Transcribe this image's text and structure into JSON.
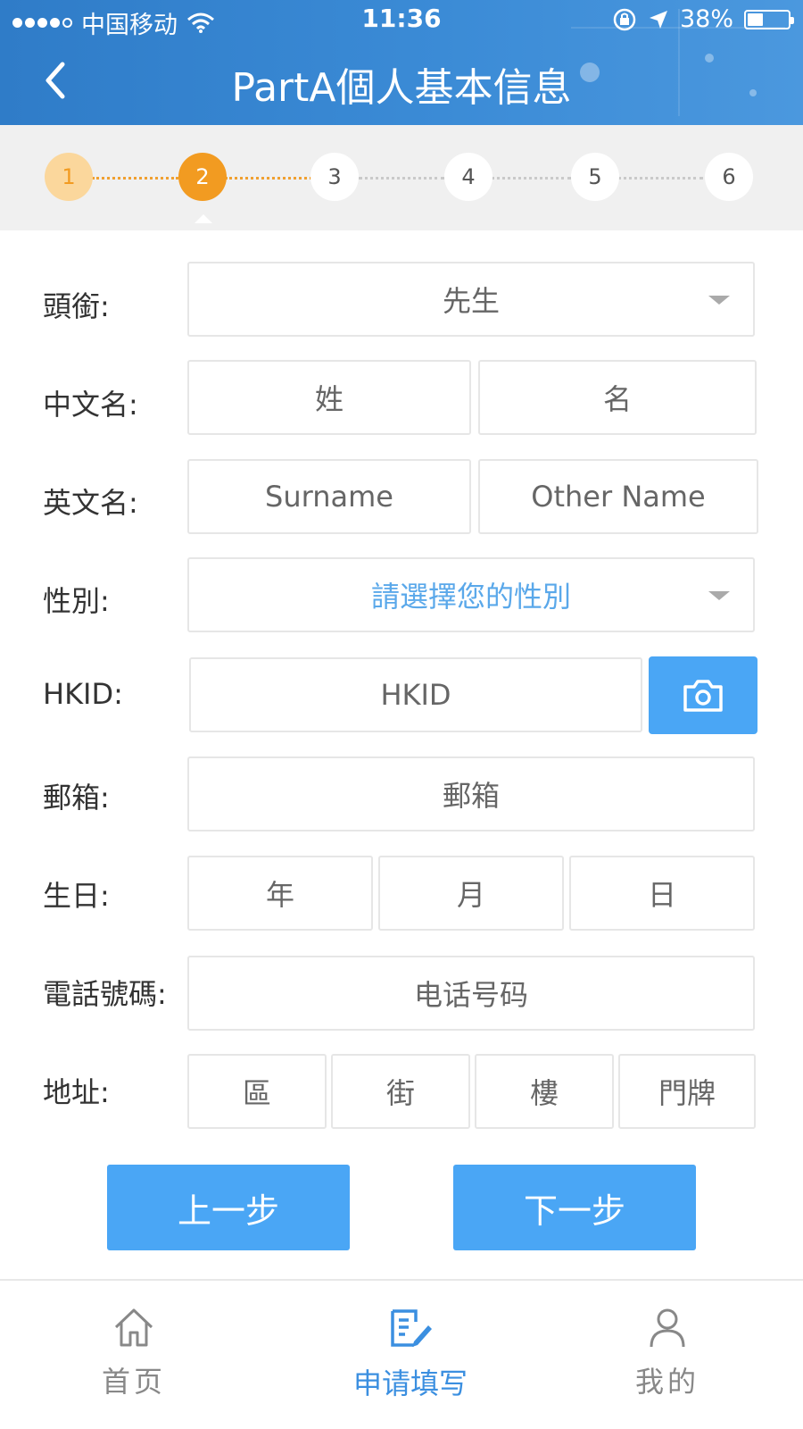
{
  "status_bar": {
    "carrier": "中国移动",
    "time": "11:36",
    "battery": "38%",
    "battery_level": 0.38
  },
  "header": {
    "title": "PartA個人基本信息"
  },
  "steps": {
    "items": [
      "1",
      "2",
      "3",
      "4",
      "5",
      "6"
    ],
    "current": 2
  },
  "form": {
    "title_label": "頭銜:",
    "title_value": "先生",
    "chinese_name_label": "中文名:",
    "chinese_surname_placeholder": "姓",
    "chinese_given_placeholder": "名",
    "english_name_label": "英文名:",
    "english_surname_placeholder": "Surname",
    "english_other_placeholder": "Other Name",
    "gender_label": "性別:",
    "gender_placeholder": "請選擇您的性別",
    "hkid_label": "HKID:",
    "hkid_placeholder": "HKID",
    "email_label": "郵箱:",
    "email_placeholder": "郵箱",
    "birthday_label": "生日:",
    "birthday_year": "年",
    "birthday_month": "月",
    "birthday_day": "日",
    "phone_label": "電話號碼:",
    "phone_placeholder": "电话号码",
    "address_label": "地址:",
    "address_district": "區",
    "address_street": "街",
    "address_floor": "樓",
    "address_number": "門牌"
  },
  "actions": {
    "prev": "上一步",
    "next": "下一步"
  },
  "tabbar": {
    "home": "首页",
    "apply": "申请填写",
    "mine": "我的"
  },
  "colors": {
    "header_blue": "#3b8bd6",
    "button_blue": "#4aa6f5",
    "step_orange": "#f29b21",
    "active_tab": "#3b8fe0"
  }
}
